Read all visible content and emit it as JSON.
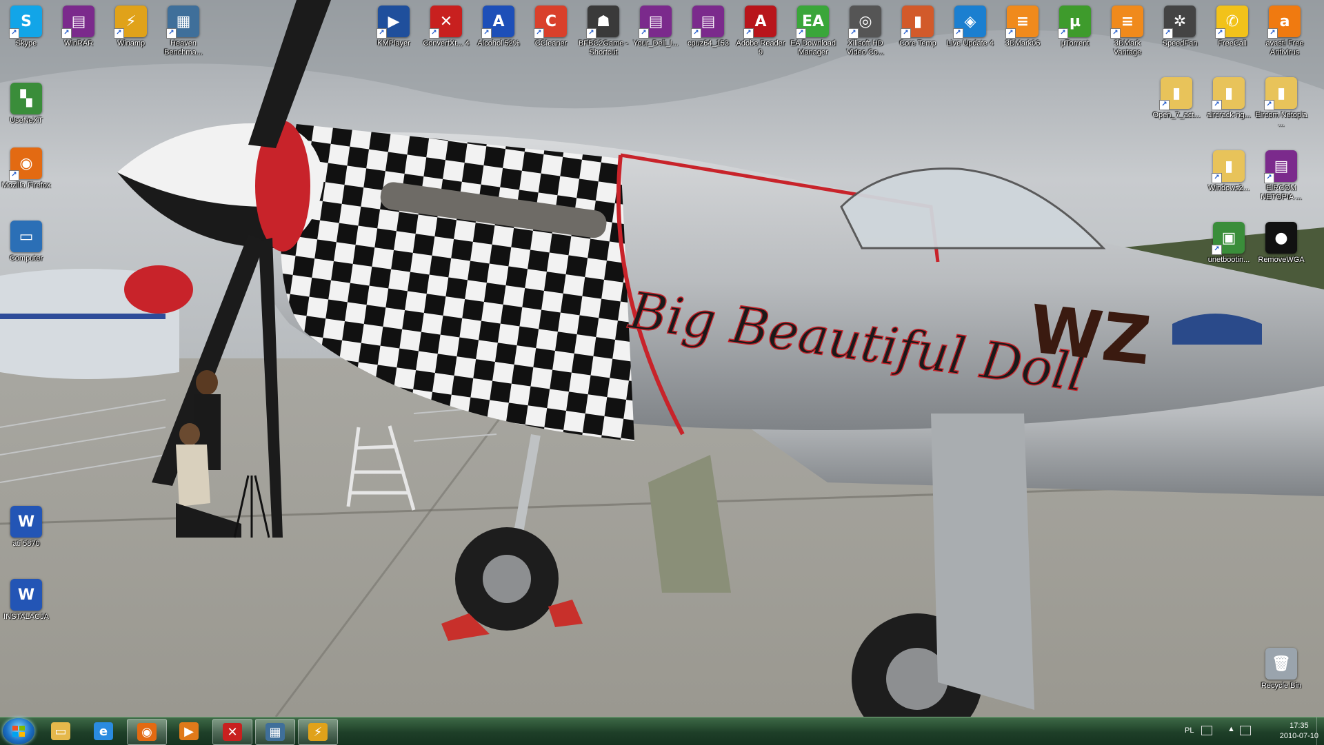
{
  "desktop": {
    "icons": [
      {
        "label": "Skype",
        "color": "#12a5e8",
        "glyph": "S"
      },
      {
        "label": "WinRAR",
        "color": "#7b2a8c",
        "glyph": "▤"
      },
      {
        "label": "Winamp",
        "color": "#e0a21a",
        "glyph": "⚡"
      },
      {
        "label": "Heaven Benchma...",
        "color": "#3f6f9a",
        "glyph": "▦"
      },
      {
        "label": "UseNeXT",
        "color": "#3a8d3a",
        "glyph": "▚"
      },
      {
        "label": "Mozilla Firefox",
        "color": "#e36a12",
        "glyph": "◉"
      },
      {
        "label": "Computer",
        "color": "#2b6fb6",
        "glyph": "▭"
      },
      {
        "label": "ati 5870",
        "color": "#2355b5",
        "glyph": "W"
      },
      {
        "label": "INSTALACJA",
        "color": "#2355b5",
        "glyph": "W"
      },
      {
        "label": "KMPlayer",
        "color": "#1f4f9c",
        "glyph": "▶"
      },
      {
        "label": "ConvertXt... 4",
        "color": "#c8201f",
        "glyph": "✕"
      },
      {
        "label": "Alcohol 52%",
        "color": "#1d4fb8",
        "glyph": "A"
      },
      {
        "label": "CCleaner",
        "color": "#d9402b",
        "glyph": "C"
      },
      {
        "label": "BFBC2Game - Shortcut",
        "color": "#3a3a3a",
        "glyph": "☗"
      },
      {
        "label": "Your_Dell_I...",
        "color": "#7b2a8c",
        "glyph": "▤"
      },
      {
        "label": "cpuz64_153",
        "color": "#7b2a8c",
        "glyph": "▤"
      },
      {
        "label": "Adobe Reader 9",
        "color": "#b8151b",
        "glyph": "A"
      },
      {
        "label": "EA Download Manager",
        "color": "#3aa63a",
        "glyph": "EA"
      },
      {
        "label": "Xilisoft HD Video Co...",
        "color": "#555555",
        "glyph": "◎"
      },
      {
        "label": "Core Temp",
        "color": "#d25a2a",
        "glyph": "▮"
      },
      {
        "label": "Live Update 4",
        "color": "#1b7fd0",
        "glyph": "◈"
      },
      {
        "label": "3DMark06",
        "color": "#f08a1c",
        "glyph": "≡"
      },
      {
        "label": "µTorrent",
        "color": "#3e9b2c",
        "glyph": "µ"
      },
      {
        "label": "3DMark Vantage",
        "color": "#f08a1c",
        "glyph": "≡"
      },
      {
        "label": "SpeedFan",
        "color": "#444444",
        "glyph": "✲"
      },
      {
        "label": "FreeCall",
        "color": "#f2c21a",
        "glyph": "✆"
      },
      {
        "label": "avast! Free Antivirus",
        "color": "#f07a10",
        "glyph": "a"
      },
      {
        "label": "Open_7_act...",
        "color": "#e8c35a",
        "glyph": "▮"
      },
      {
        "label": "aircrack-ng...",
        "color": "#e8c35a",
        "glyph": "▮"
      },
      {
        "label": "Eircom Netopia ...",
        "color": "#e8c35a",
        "glyph": "▮"
      },
      {
        "label": "Windows2...",
        "color": "#e8c35a",
        "glyph": "▮"
      },
      {
        "label": "EIRCOM NETOPIA ...",
        "color": "#7b2a8c",
        "glyph": "▤"
      },
      {
        "label": "unetbootin...",
        "color": "#3a8d3a",
        "glyph": "▣"
      },
      {
        "label": "RemoveWGA",
        "color": "#111111",
        "glyph": "●"
      },
      {
        "label": "Recycle Bin",
        "color": "#9aa4ad",
        "glyph": "🗑"
      }
    ]
  },
  "taskbar": {
    "pinned": [
      {
        "name": "explorer",
        "color": "#e5b84b",
        "glyph": "▭"
      },
      {
        "name": "internet-explorer",
        "color": "#2a8be0",
        "glyph": "e"
      },
      {
        "name": "firefox",
        "color": "#e36a12",
        "glyph": "◉"
      },
      {
        "name": "media-player",
        "color": "#e07a1a",
        "glyph": "▶"
      },
      {
        "name": "convertxtodvd",
        "color": "#c8201f",
        "glyph": "✕"
      },
      {
        "name": "heaven-benchmark",
        "color": "#3f6f9a",
        "glyph": "▦"
      },
      {
        "name": "winamp",
        "color": "#e0a21a",
        "glyph": "⚡"
      }
    ],
    "tray": {
      "language": "PL",
      "time": "17:35",
      "date": "2010-07-10"
    }
  },
  "wallpaper": {
    "nose_art": "Big Beautiful Doll",
    "code": "WZ"
  }
}
